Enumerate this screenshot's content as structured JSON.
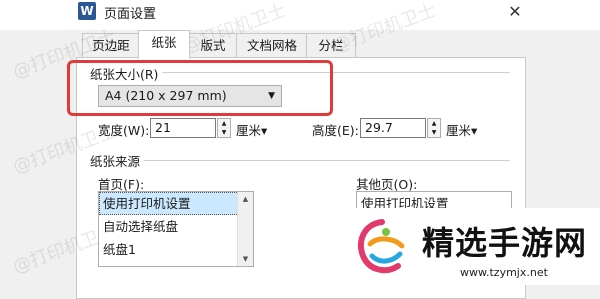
{
  "window": {
    "title": "页面设置",
    "app_icon_letter": "W",
    "close_label": "✕"
  },
  "tabs": [
    "页边距",
    "纸张",
    "版式",
    "文档网格",
    "分栏"
  ],
  "paper_size": {
    "section_label": "纸张大小(R)",
    "selected": "A4 (210 x 297 mm)",
    "width_label": "宽度(W):",
    "width_value": "21",
    "width_unit": "厘米▾",
    "height_label": "高度(E):",
    "height_value": "29.7",
    "height_unit": "厘米▾"
  },
  "paper_source": {
    "section_label": "纸张来源",
    "first_page_label": "首页(F):",
    "first_page_items": [
      "使用打印机设置",
      "自动选择纸盘",
      "纸盘1"
    ],
    "other_pages_label": "其他页(O):",
    "other_pages_items": [
      "使用打印机设置"
    ]
  },
  "watermarks": [
    "@打印机卫士",
    "@打印机卫士",
    "@打印机卫士",
    "@打印机卫士",
    "@打印机卫士"
  ],
  "brand": {
    "name": "精选手游网",
    "url": "www.tzymjx.net"
  },
  "colors": {
    "highlight": "#e03b3b",
    "selected_row": "#cce8ff"
  }
}
